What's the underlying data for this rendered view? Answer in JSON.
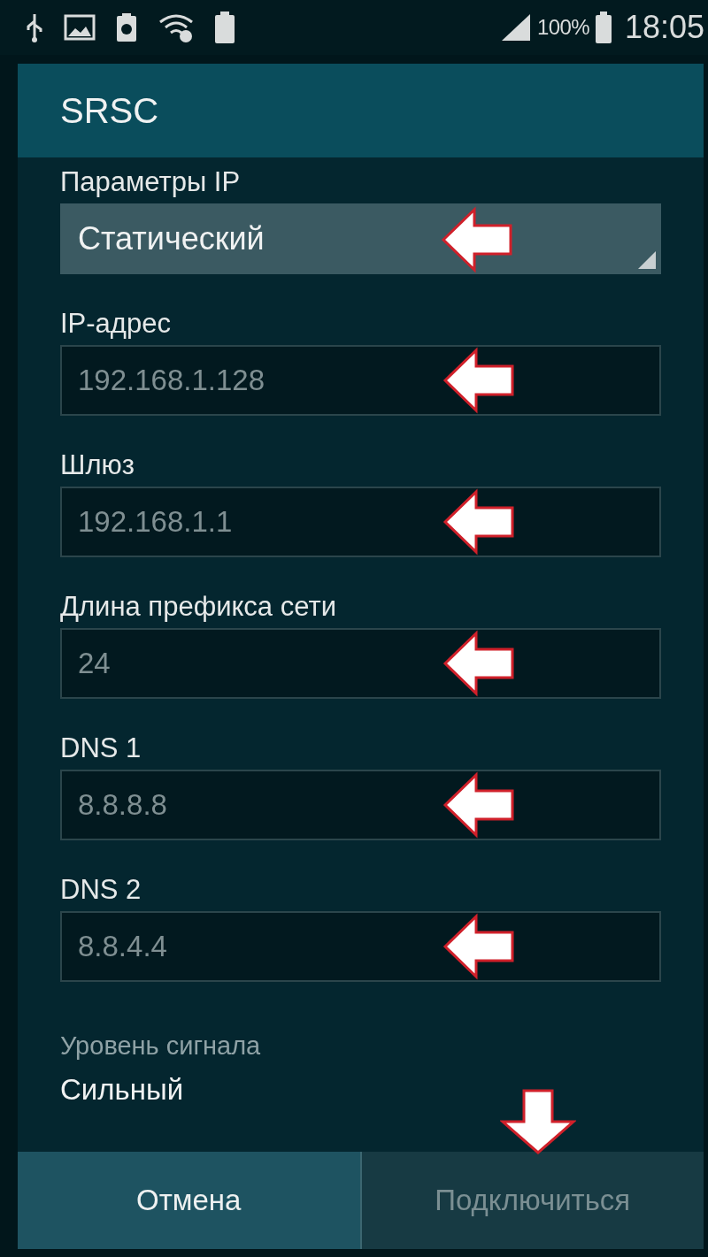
{
  "status_bar": {
    "battery_text": "100%",
    "time": "18:05"
  },
  "dialog": {
    "title": "SRSC",
    "ip_settings": {
      "label": "Параметры IP",
      "value": "Статический"
    },
    "fields": [
      {
        "label": "IP-адрес",
        "value": "192.168.1.128"
      },
      {
        "label": "Шлюз",
        "value": "192.168.1.1"
      },
      {
        "label": "Длина префикса сети",
        "value": "24"
      },
      {
        "label": "DNS 1",
        "value": "8.8.8.8"
      },
      {
        "label": "DNS 2",
        "value": "8.8.4.4"
      }
    ],
    "signal": {
      "label": "Уровень сигнала",
      "value": "Сильный"
    },
    "buttons": [
      {
        "label": "Отмена",
        "disabled": false
      },
      {
        "label": "Подключиться",
        "disabled": true
      }
    ]
  }
}
